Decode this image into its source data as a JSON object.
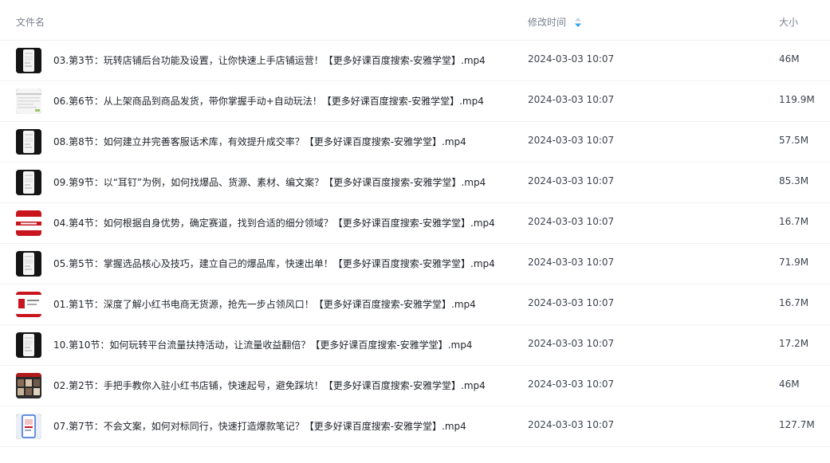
{
  "header": {
    "name_label": "文件名",
    "time_label": "修改时间",
    "size_label": "大小",
    "sort_icon": "sort-desc-icon"
  },
  "files": [
    {
      "name": "03.第3节：玩转店铺后台功能及设置，让你快速上手店铺运营！【更多好课百度搜索-安雅学堂】.mp4",
      "time": "2024-03-03 10:07",
      "size": "46M",
      "thumb": "phone-dark"
    },
    {
      "name": "06.第6节：从上架商品到商品发货，带你掌握手动+自动玩法！【更多好课百度搜索-安雅学堂】.mp4",
      "time": "2024-03-03 10:07",
      "size": "119.9M",
      "thumb": "screen-light"
    },
    {
      "name": "08.第8节：如何建立并完善客服话术库，有效提升成交率？【更多好课百度搜索-安雅学堂】.mp4",
      "time": "2024-03-03 10:07",
      "size": "57.5M",
      "thumb": "phone-dark"
    },
    {
      "name": "09.第9节：以“耳钉”为例，如何找爆品、货源、素材、编文案？【更多好课百度搜索-安雅学堂】.mp4",
      "time": "2024-03-03 10:07",
      "size": "85.3M",
      "thumb": "phone-dark"
    },
    {
      "name": "04.第4节：如何根据自身优势，确定赛道，找到合适的细分领域？【更多好课百度搜索-安雅学堂】.mp4",
      "time": "2024-03-03 10:07",
      "size": "16.7M",
      "thumb": "red-banner"
    },
    {
      "name": "05.第5节：掌握选品核心及技巧，建立自己的爆品库，快速出单！【更多好课百度搜索-安雅学堂】.mp4",
      "time": "2024-03-03 10:07",
      "size": "71.9M",
      "thumb": "phone-dark"
    },
    {
      "name": "01.第1节：深度了解小红书电商无货源，抢先一步占领风口！【更多好课百度搜索-安雅学堂】.mp4",
      "time": "2024-03-03 10:07",
      "size": "16.7M",
      "thumb": "red-slide"
    },
    {
      "name": "10.第10节：如何玩转平台流量扶持活动，让流量收益翻倍？【更多好课百度搜索-安雅学堂】.mp4",
      "time": "2024-03-03 10:07",
      "size": "17.2M",
      "thumb": "phone-dark"
    },
    {
      "name": "02.第2节：手把手教你入驻小红书店铺，快速起号，避免踩坑！【更多好课百度搜索-安雅学堂】.mp4",
      "time": "2024-03-03 10:07",
      "size": "46M",
      "thumb": "photo-grid"
    },
    {
      "name": "07.第7节：不会文案，如何对标同行，快速打造爆款笔记？【更多好课百度搜索-安雅学堂】.mp4",
      "time": "2024-03-03 10:07",
      "size": "127.7M",
      "thumb": "phone-blue"
    }
  ],
  "colors": {
    "header_text": "#7a818d",
    "body_text": "#1f2329",
    "sort_active": "#2aa2f5",
    "sort_inactive": "#c9d3de",
    "divider": "#f1f2f4"
  }
}
